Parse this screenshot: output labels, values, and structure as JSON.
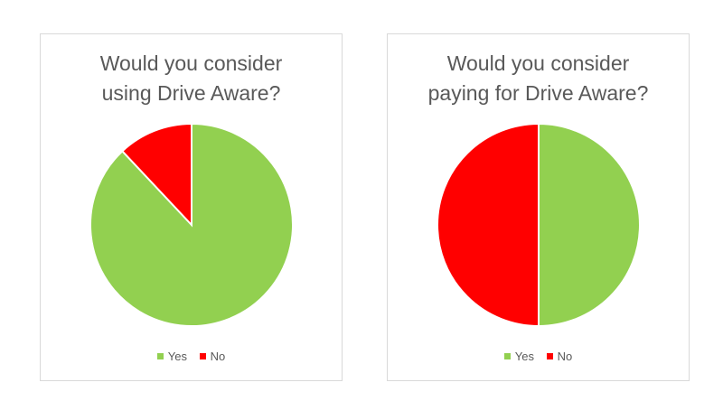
{
  "chart_data": [
    {
      "type": "pie",
      "title_lines": [
        "Would you consider",
        "using Drive Aware?"
      ],
      "categories": [
        "Yes",
        "No"
      ],
      "values": [
        88,
        12
      ],
      "colors": [
        "#92d050",
        "#ff0000"
      ],
      "legend_position": "bottom"
    },
    {
      "type": "pie",
      "title_lines": [
        "Would you consider",
        "paying for Drive Aware?"
      ],
      "categories": [
        "Yes",
        "No"
      ],
      "values": [
        50,
        50
      ],
      "colors": [
        "#92d050",
        "#ff0000"
      ],
      "legend_position": "bottom"
    }
  ]
}
